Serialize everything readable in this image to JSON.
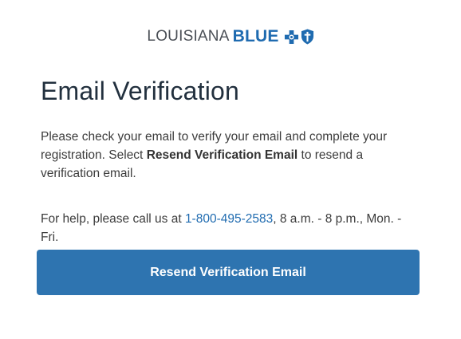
{
  "logo": {
    "state_text": "LOUISIANA",
    "brand_text": "BLUE"
  },
  "page": {
    "title": "Email Verification"
  },
  "instructions": {
    "part1": "Please check your email to verify your email and complete your registration. Select ",
    "bold": "Resend Verification Email",
    "part2": " to resend a verification email."
  },
  "help": {
    "prefix": "For help, please call us at ",
    "phone": "1-800-495-2583",
    "suffix": ", 8 a.m. - 8 p.m., Mon. - Fri."
  },
  "actions": {
    "resend_label": "Resend Verification Email"
  },
  "colors": {
    "brand_blue": "#1f6bb0",
    "button_blue": "#2e74b0",
    "title": "#22303e"
  },
  "icons": [
    "blue-cross-icon",
    "blue-shield-icon"
  ]
}
